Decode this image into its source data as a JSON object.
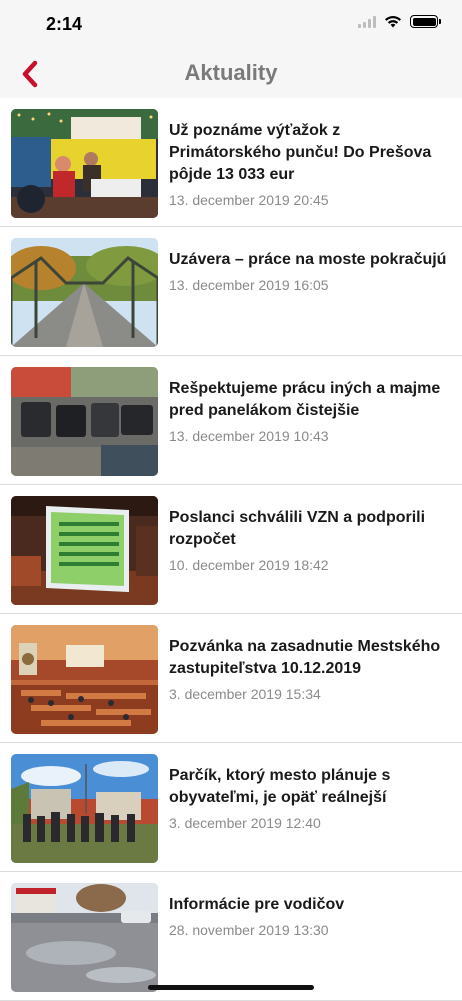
{
  "status": {
    "time": "2:14"
  },
  "nav": {
    "title": "Aktuality",
    "back_icon": "chevron-left-icon",
    "accent": "#c8102e"
  },
  "articles": [
    {
      "title": "Už poznáme výťažok z Primátorského punču! Do Prešova pôjde 13 033 eur",
      "date": "13. december 2019 20:45"
    },
    {
      "title": "Uzávera – práce na moste pokračujú",
      "date": "13. december 2019 16:05"
    },
    {
      "title": "Rešpektujeme prácu iných a majme pred panelákom čistejšie",
      "date": "13. december 2019 10:43"
    },
    {
      "title": "Poslanci schválili VZN a podporili rozpočet",
      "date": "10. december 2019 18:42"
    },
    {
      "title": "Pozvánka na zasadnutie Mestského zastupiteľstva 10.12.2019",
      "date": "3. december 2019 15:34"
    },
    {
      "title": "Parčík, ktorý mesto plánuje s obyvateľmi, je opäť reálnejší",
      "date": "3. december 2019 12:40"
    },
    {
      "title": "Informácie pre vodičov",
      "date": "28. november 2019 13:30"
    }
  ]
}
